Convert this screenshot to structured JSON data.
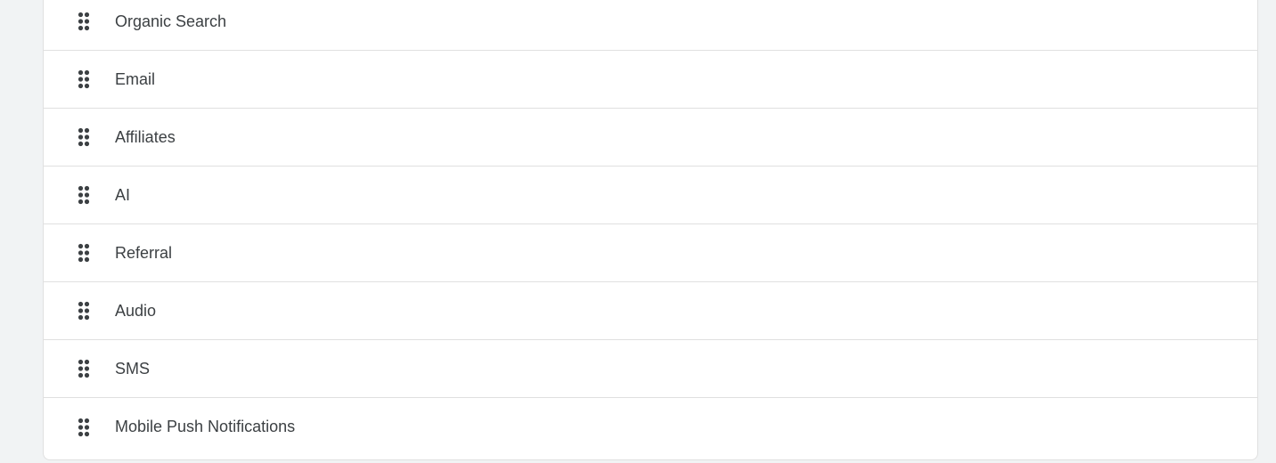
{
  "channels": {
    "items": [
      {
        "label": "Organic Search",
        "icon": "drag-handle-icon"
      },
      {
        "label": "Email",
        "icon": "drag-handle-icon"
      },
      {
        "label": "Affiliates",
        "icon": "drag-handle-icon"
      },
      {
        "label": "AI",
        "icon": "drag-handle-icon"
      },
      {
        "label": "Referral",
        "icon": "drag-handle-icon"
      },
      {
        "label": "Audio",
        "icon": "drag-handle-icon"
      },
      {
        "label": "SMS",
        "icon": "drag-handle-icon"
      },
      {
        "label": "Mobile Push Notifications",
        "icon": "drag-handle-icon"
      }
    ]
  },
  "colors": {
    "background": "#f1f3f4",
    "panel": "#ffffff",
    "divider": "#e0e0e0",
    "text": "#3c4043",
    "handle": "#3c4043"
  }
}
